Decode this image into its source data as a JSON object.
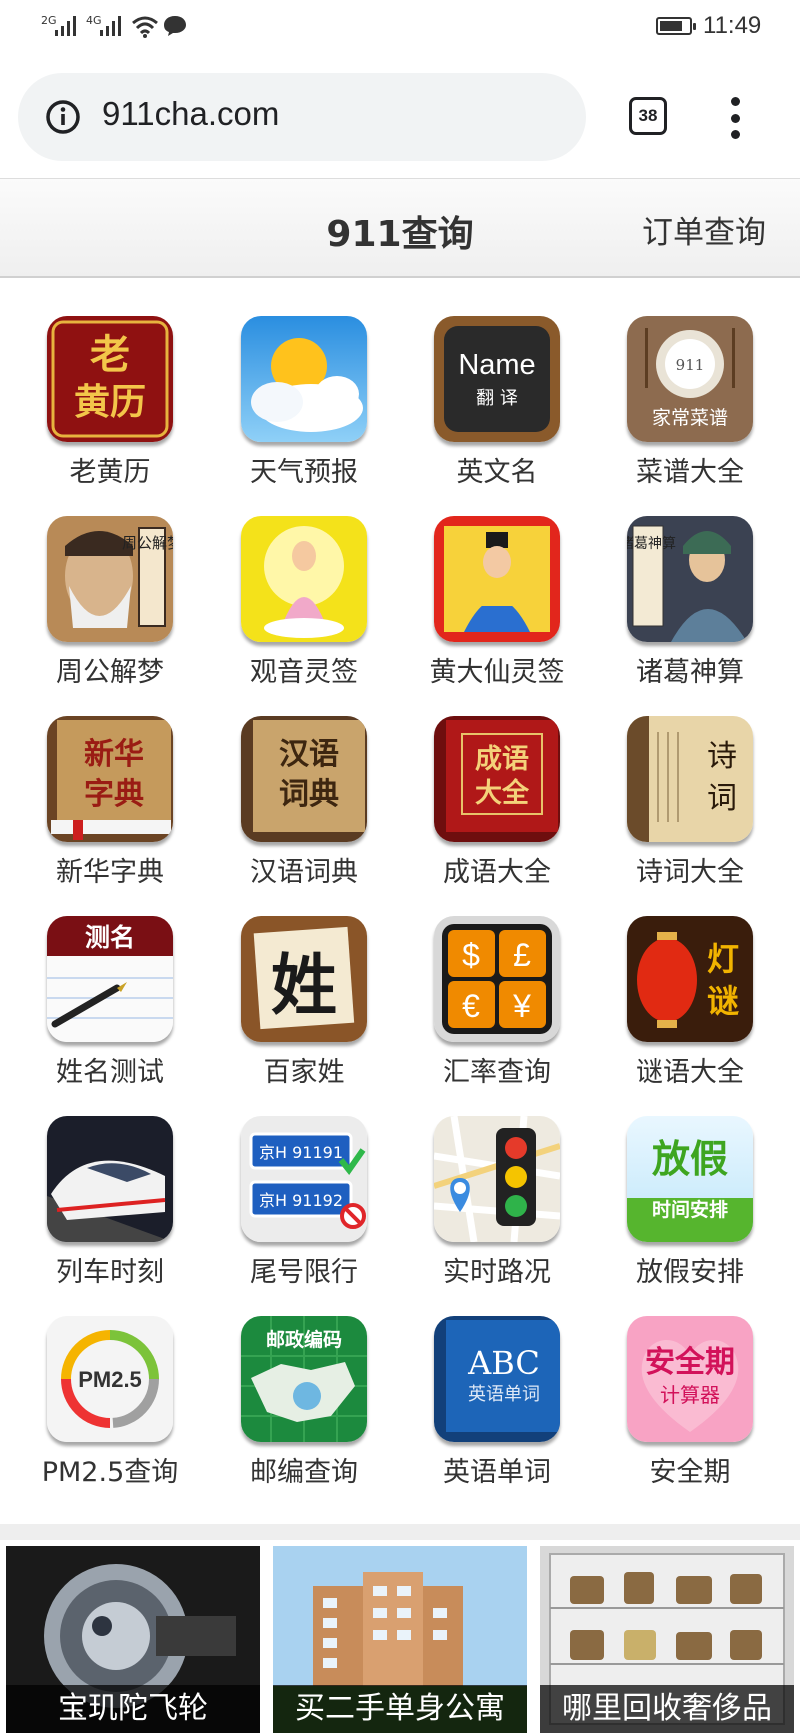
{
  "status_bar": {
    "signal1_label": "2G",
    "signal2_label": "4G",
    "time": "11:49",
    "battery_level": 0.8
  },
  "browser": {
    "url": "911cha.com",
    "tab_count": "38"
  },
  "header": {
    "title": "911查询",
    "order_link": "订单查询"
  },
  "apps": [
    {
      "label": "老黄历",
      "icon": "huangli-icon"
    },
    {
      "label": "天气预报",
      "icon": "weather-icon"
    },
    {
      "label": "英文名",
      "icon": "english-name-icon"
    },
    {
      "label": "菜谱大全",
      "icon": "recipe-icon"
    },
    {
      "label": "周公解梦",
      "icon": "dream-icon"
    },
    {
      "label": "观音灵签",
      "icon": "guanyin-icon"
    },
    {
      "label": "黄大仙灵签",
      "icon": "huangdaxian-icon"
    },
    {
      "label": "诸葛神算",
      "icon": "zhuge-icon"
    },
    {
      "label": "新华字典",
      "icon": "xinhua-dictionary-icon"
    },
    {
      "label": "汉语词典",
      "icon": "chinese-dictionary-icon"
    },
    {
      "label": "成语大全",
      "icon": "idiom-book-icon"
    },
    {
      "label": "诗词大全",
      "icon": "poetry-scroll-icon"
    },
    {
      "label": "姓名测试",
      "icon": "name-test-icon"
    },
    {
      "label": "百家姓",
      "icon": "surname-icon"
    },
    {
      "label": "汇率查询",
      "icon": "currency-icon"
    },
    {
      "label": "谜语大全",
      "icon": "riddle-lantern-icon"
    },
    {
      "label": "列车时刻",
      "icon": "train-icon"
    },
    {
      "label": "尾号限行",
      "icon": "license-plate-icon"
    },
    {
      "label": "实时路况",
      "icon": "traffic-light-icon"
    },
    {
      "label": "放假安排",
      "icon": "holiday-icon"
    },
    {
      "label": "PM2.5查询",
      "icon": "pm25-gauge-icon"
    },
    {
      "label": "邮编查询",
      "icon": "postcode-map-icon"
    },
    {
      "label": "英语单词",
      "icon": "english-words-book-icon"
    },
    {
      "label": "安全期",
      "icon": "safe-period-icon"
    }
  ],
  "tile_text": {
    "huangli": [
      "老",
      "黄历"
    ],
    "name_en": "Name",
    "name_zh": "翻 译",
    "recipe_num": "911",
    "recipe_label": "家常菜谱",
    "dream": "周公解梦",
    "zhuge": "诸葛神算",
    "xinhua": [
      "新华",
      "字典"
    ],
    "cidian": [
      "汉语",
      "词典"
    ],
    "chengyu": [
      "成语",
      "大全"
    ],
    "shici": [
      "诗",
      "词"
    ],
    "ceming": "测名",
    "surname": "姓",
    "currency": [
      "$",
      "£",
      "€",
      "¥"
    ],
    "riddle": [
      "灯",
      "谜"
    ],
    "plate1": "京H 91191",
    "plate2": "京H 91192",
    "holiday_big": "放假",
    "holiday_small": "时间安排",
    "pm25": "PM2.5",
    "postcode": "邮政编码",
    "abc": "ABC",
    "abc_sub": "英语单词",
    "safe": "安全期",
    "safe_sub": "计算器"
  },
  "ads": [
    {
      "caption": "宝玑陀飞轮"
    },
    {
      "caption": "买二手单身公寓"
    },
    {
      "caption": "哪里回收奢侈品"
    }
  ],
  "colors": {
    "accent_dark": "#202124",
    "header_bg": "#f2f2f2",
    "text": "#333333"
  }
}
